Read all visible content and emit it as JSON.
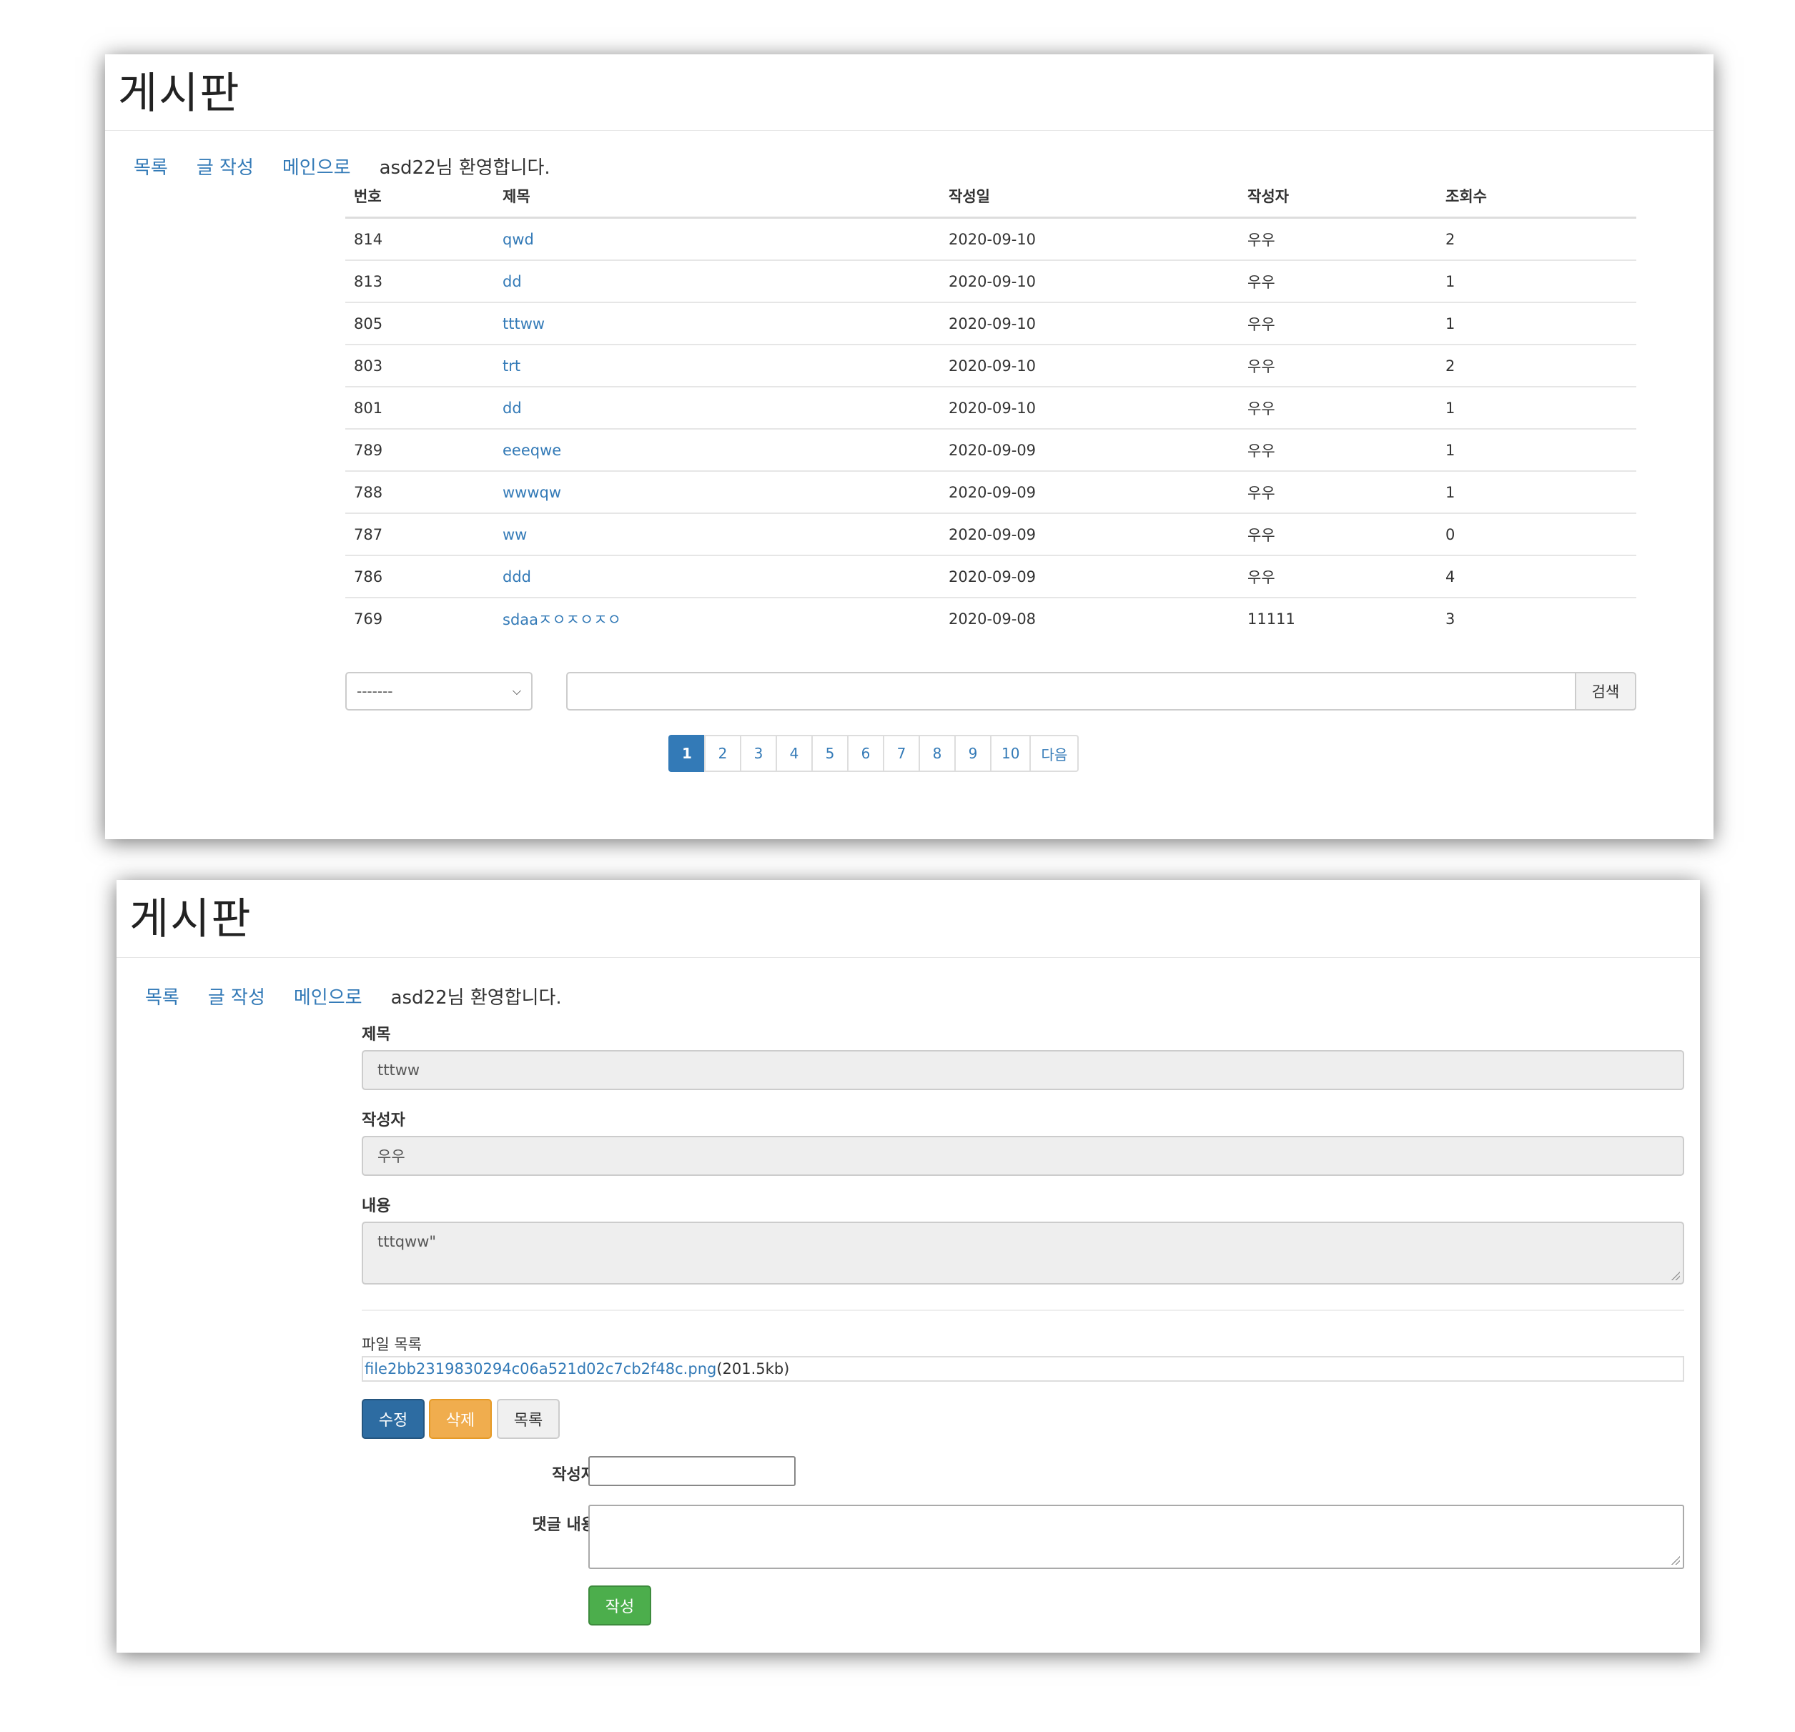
{
  "board_title": "게시판",
  "nav": {
    "list": "목록",
    "write": "글 작성",
    "main": "메인으로",
    "welcome": "asd22님 환영합니다."
  },
  "table": {
    "headers": [
      "번호",
      "제목",
      "작성일",
      "작성자",
      "조회수"
    ],
    "rows": [
      {
        "no": "814",
        "title": "qwd",
        "date": "2020-09-10",
        "author": "우우",
        "views": "2"
      },
      {
        "no": "813",
        "title": "dd",
        "date": "2020-09-10",
        "author": "우우",
        "views": "1"
      },
      {
        "no": "805",
        "title": "tttww",
        "date": "2020-09-10",
        "author": "우우",
        "views": "1"
      },
      {
        "no": "803",
        "title": "trt",
        "date": "2020-09-10",
        "author": "우우",
        "views": "2"
      },
      {
        "no": "801",
        "title": "dd",
        "date": "2020-09-10",
        "author": "우우",
        "views": "1"
      },
      {
        "no": "789",
        "title": "eeeqwe",
        "date": "2020-09-09",
        "author": "우우",
        "views": "1"
      },
      {
        "no": "788",
        "title": "wwwqw",
        "date": "2020-09-09",
        "author": "우우",
        "views": "1"
      },
      {
        "no": "787",
        "title": "ww",
        "date": "2020-09-09",
        "author": "우우",
        "views": "0"
      },
      {
        "no": "786",
        "title": "ddd",
        "date": "2020-09-09",
        "author": "우우",
        "views": "4"
      },
      {
        "no": "769",
        "title": "sdaaㅈㅇㅈㅇㅈㅇ",
        "date": "2020-09-08",
        "author": "11111",
        "views": "3"
      }
    ]
  },
  "search": {
    "select_value": "-------",
    "button": "검색"
  },
  "pagination": {
    "pages": [
      "1",
      "2",
      "3",
      "4",
      "5",
      "6",
      "7",
      "8",
      "9",
      "10"
    ],
    "active": "1",
    "next": "다음"
  },
  "detail": {
    "title_label": "제목",
    "title_value": "tttww",
    "author_label": "작성자",
    "author_value": "우우",
    "content_label": "내용",
    "content_value": "tttqww\"",
    "files_label": "파일 목록",
    "file_name": "file2bb2319830294c06a521d02c7cb2f48c.png",
    "file_size": "(201.5kb)",
    "edit_button": "수정",
    "delete_button": "삭제",
    "list_button": "목록"
  },
  "comment_form": {
    "author_label": "작성자",
    "content_label": "댓글 내용",
    "submit_button": "작성"
  },
  "colors": {
    "link": "#337ab7",
    "primary": "#2d6ca2",
    "warning": "#f0ad4e",
    "success": "#4cae4c"
  }
}
